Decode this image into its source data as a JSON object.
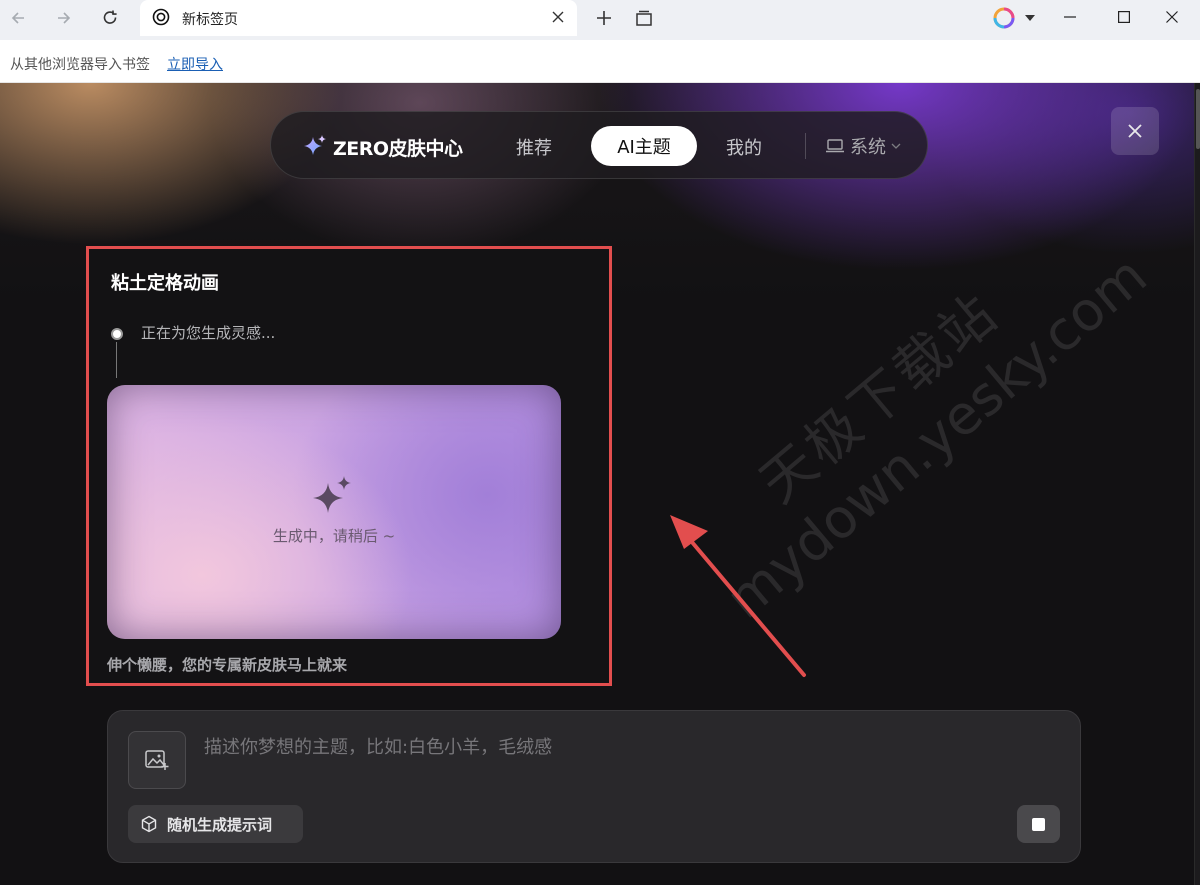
{
  "browser": {
    "tab_title": "新标签页",
    "bookmark_hint": "从其他浏览器导入书签",
    "import_link": "立即导入"
  },
  "skin_center": {
    "brand": "ZERO皮肤中心",
    "tabs": [
      {
        "label": "推荐",
        "active": false
      },
      {
        "label": "AI主题",
        "active": true
      },
      {
        "label": "我的",
        "active": false
      }
    ],
    "system_select": "系统"
  },
  "generation": {
    "theme_title": "粘土定格动画",
    "step_status": "正在为您生成灵感...",
    "preview_status": "生成中，请稍后 ~",
    "footer_message": "伸个懒腰，您的专属新皮肤马上就来"
  },
  "prompt": {
    "placeholder": "描述你梦想的主题，比如:白色小羊，毛绒感",
    "value": "",
    "random_button": "随机生成提示词"
  },
  "watermark": {
    "line1": "天极下载站",
    "line2": "mydown.yesky.com"
  },
  "colors": {
    "highlight_border": "#e24e4e",
    "annotation_arrow": "#e24e4e",
    "accent_purple": "#7a3ad2"
  }
}
